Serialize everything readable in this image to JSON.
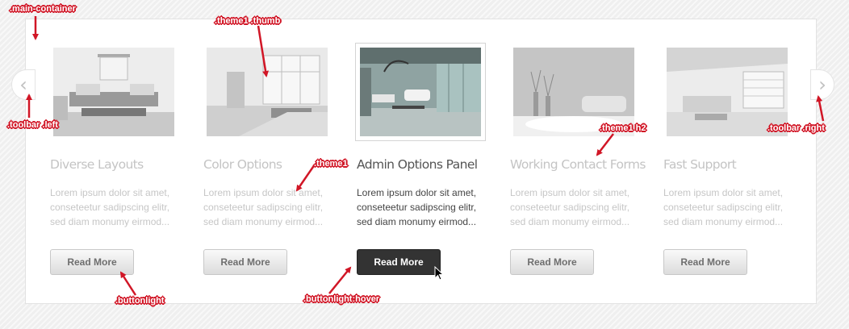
{
  "carousel": {
    "nav_left_glyph": "‹",
    "nav_right_glyph": "›",
    "items": [
      {
        "title": "Diverse Layouts",
        "text": "Lorem ipsum dolor sit amet,\nconseteetur sadipscing elitr,\nsed diam monumy eirmod...",
        "button": "Read More",
        "image_icon": "living-room-photo"
      },
      {
        "title": "Color Options",
        "text": "Lorem ipsum dolor sit amet,\nconseteetur sadipscing elitr,\nsed diam monumy eirmod...",
        "button": "Read More",
        "image_icon": "sunlit-room-photo"
      },
      {
        "title": "Admin Options Panel",
        "text": "Lorem ipsum dolor sit amet,\nconseteetur sadipscing elitr,\nsed diam monumy eirmod...",
        "button": "Read More",
        "image_icon": "modern-lounge-photo"
      },
      {
        "title": "Working Contact Forms",
        "text": "Lorem ipsum dolor sit amet,\nconseteetur sadipscing elitr,\nsed diam monumy eirmod...",
        "button": "Read More",
        "image_icon": "sofa-room-photo"
      },
      {
        "title": "Fast Support",
        "text": "Lorem ipsum dolor sit amet,\nconseteetur sadipscing elitr,\nsed diam monumy eirmod...",
        "button": "Read More",
        "image_icon": "bright-living-room-photo"
      }
    ]
  },
  "annotations": {
    "main_container": ".main-container",
    "thumb": ".theme1 .thumb",
    "toolbar_left": ".toolbar .left",
    "toolbar_right": ".toolbar .right",
    "h2": ".theme1 h2",
    "theme1": ".theme1",
    "buttonlight": ".buttonlight",
    "buttonlight_hover": ".buttonlight:hover"
  },
  "colors": {
    "annotation_red": "#d11626",
    "active_button": "#333333",
    "inactive_text": "#c4c4c4",
    "active_text": "#555555"
  }
}
